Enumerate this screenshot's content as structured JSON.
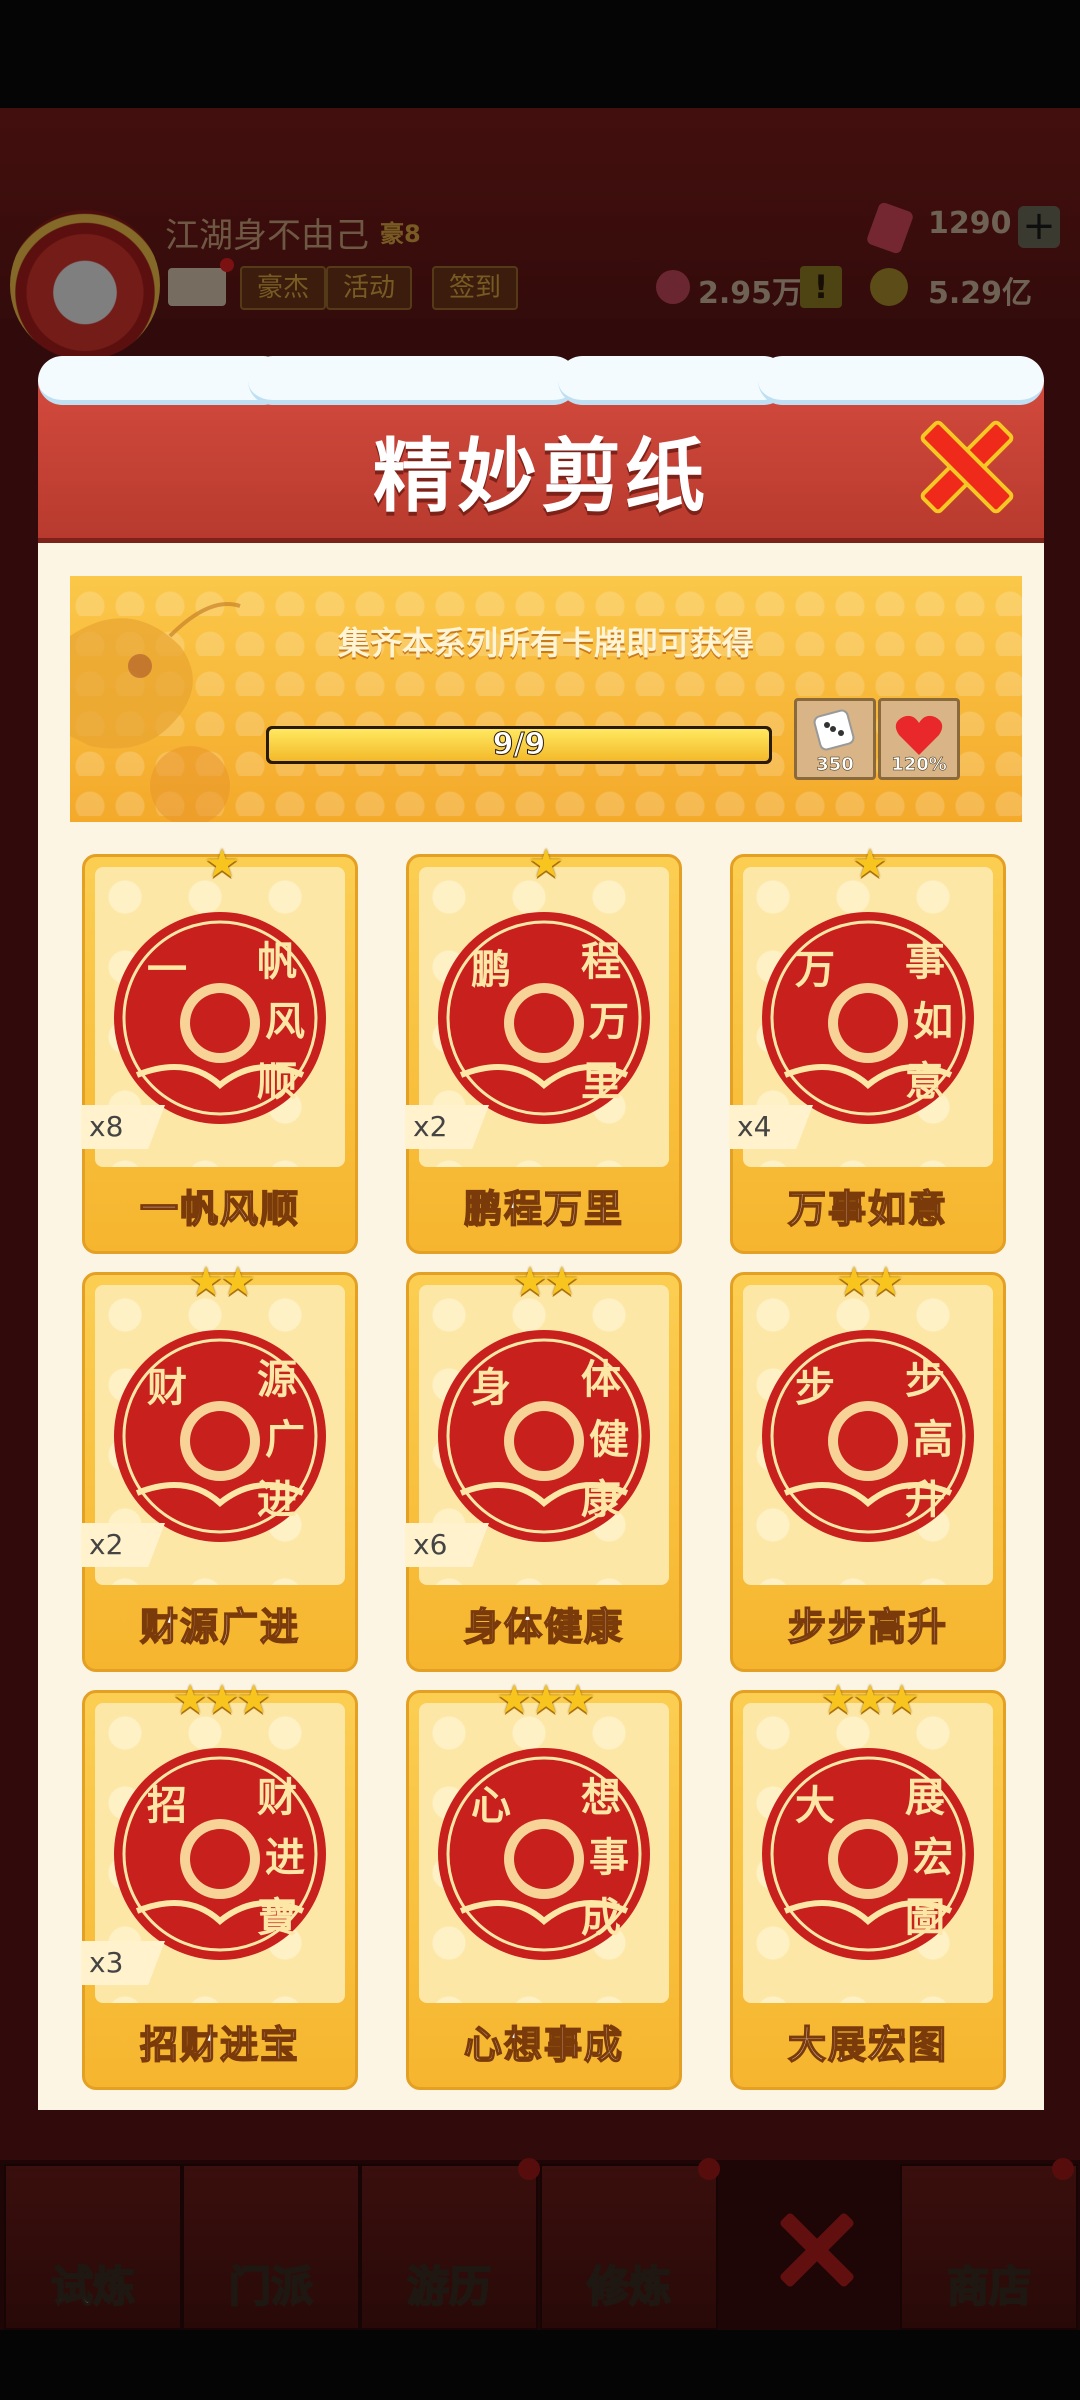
{
  "player": {
    "name": "江湖身不由己",
    "vip": "豪8"
  },
  "header_buttons": [
    "豪杰",
    "活动",
    "签到"
  ],
  "resources": {
    "gems": "1290",
    "tickets": "2.95万",
    "coins": "5.29亿"
  },
  "modal": {
    "title": "精妙剪纸",
    "banner_text": "集齐本系列所有卡牌即可获得",
    "progress_text": "9/9",
    "progress_fraction": 1.0,
    "rewards": [
      {
        "icon": "dice-icon",
        "label": "350"
      },
      {
        "icon": "heart-icon",
        "label": "120%"
      }
    ]
  },
  "cards": [
    {
      "name": "一帆风顺",
      "stars": "★",
      "count": "x8",
      "art_chars": [
        "一",
        "帆",
        "风",
        "顺"
      ]
    },
    {
      "name": "鹏程万里",
      "stars": "★",
      "count": "x2",
      "art_chars": [
        "鹏",
        "程",
        "万",
        "里"
      ]
    },
    {
      "name": "万事如意",
      "stars": "★",
      "count": "x4",
      "art_chars": [
        "万",
        "事",
        "如",
        "意"
      ]
    },
    {
      "name": "财源广进",
      "stars": "★★",
      "count": "x2",
      "art_chars": [
        "财",
        "源",
        "广",
        "进"
      ]
    },
    {
      "name": "身体健康",
      "stars": "★★",
      "count": "x6",
      "art_chars": [
        "身",
        "体",
        "健",
        "康"
      ]
    },
    {
      "name": "步步高升",
      "stars": "★★",
      "count": "",
      "art_chars": [
        "步",
        "步",
        "高",
        "升"
      ]
    },
    {
      "name": "招财进宝",
      "stars": "★★★",
      "count": "x3",
      "art_chars": [
        "招",
        "财",
        "进",
        "寶"
      ]
    },
    {
      "name": "心想事成",
      "stars": "★★★",
      "count": "",
      "art_chars": [
        "心",
        "想",
        "事",
        "成"
      ]
    },
    {
      "name": "大展宏图",
      "stars": "★★★",
      "count": "",
      "art_chars": [
        "大",
        "展",
        "宏",
        "圖"
      ]
    }
  ],
  "bottom_nav": [
    "试炼",
    "门派",
    "游历",
    "修炼",
    "",
    "商店"
  ],
  "colors": {
    "paper_red": "#c8201c",
    "card_gold": "#f6b52e",
    "header_red": "#c4402f"
  }
}
